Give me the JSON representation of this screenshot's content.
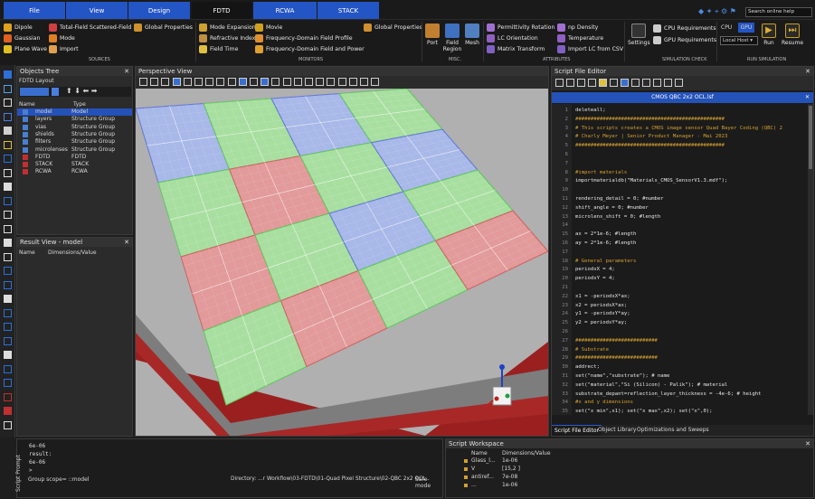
{
  "tabs": [
    "File",
    "View",
    "Design",
    "FDTD",
    "RCWA",
    "STACK"
  ],
  "search_placeholder": "Search online help",
  "sources": {
    "col1": [
      "Dipole",
      "Gaussian",
      "Plane Wave"
    ],
    "col2": [
      "Total-Field Scattered-Field",
      "Mode",
      "Import"
    ],
    "col3": [
      "Global Properties"
    ],
    "label": "Sources"
  },
  "monitors": {
    "col1": [
      "Mode Expansion",
      "Refractive Index",
      "Field Time"
    ],
    "col2": [
      "Movie",
      "Frequency-Domain Field Profile",
      "Frequency-Domain Field and Power"
    ],
    "col3": [
      "Global Properties"
    ],
    "label": "Monitors"
  },
  "misc": {
    "items": [
      "Port",
      "Field Region",
      "Mesh"
    ],
    "label": "Misc."
  },
  "attributes": {
    "col1": [
      "Permittivity Rotation",
      "LC Orientation",
      "Matrix Transform"
    ],
    "col2": [
      "np Density",
      "Temperature",
      "Import LC from CSV"
    ],
    "label": "Attributes"
  },
  "settings_label": "Settings",
  "sim_check": {
    "items": [
      "CPU Requirements",
      "GPU Requirements"
    ],
    "label": "Simulation Check"
  },
  "run_sim": {
    "cpu": "CPU",
    "gpu": "GPU",
    "host": "Local Host",
    "run": "Run",
    "resume": "Resume",
    "label": "Run Simulation"
  },
  "objects_tree": {
    "title": "Objects Tree",
    "subtitle": "FDTD Layout",
    "col_name": "Name",
    "col_type": "Type",
    "rows": [
      [
        "model",
        "Model"
      ],
      [
        "layers",
        "Structure Group"
      ],
      [
        "vias",
        "Structure Group"
      ],
      [
        "shields",
        "Structure Group"
      ],
      [
        "filters",
        "Structure Group"
      ],
      [
        "microlenses",
        "Structure Group"
      ],
      [
        "FDTD",
        "FDTD"
      ],
      [
        "STACK",
        "STACK"
      ],
      [
        "RCWA",
        "RCWA"
      ]
    ]
  },
  "result_view": {
    "title": "Result View - model",
    "col_name": "Name",
    "col_dim": "Dimensions/Value"
  },
  "perspective": {
    "title": "Perspective View"
  },
  "editor": {
    "title": "Script File Editor",
    "file": "CMOS QBC 2x2 OCL.lsf",
    "lines": [
      "deleteall;",
      "#################################################",
      "# This scripts creates a CMOS image sensor Quad Bayer Coding (QBC) 2",
      "# Charly Meyer | Senior Product Manager - Mai 2023",
      "#################################################",
      "",
      "",
      "#import materials",
      "importmaterialdb(\"Materials_CMOS_SensorV1.3.mdf\");",
      "",
      "rendering_detail = 0; #number",
      "shift_angle = 0; #number",
      "microlens_shift = 0; #length",
      "",
      "ax = 2*1e-6; #length",
      "ay = 2*1e-6; #length",
      "",
      "# General parameters",
      "periodsX = 4;",
      "periodsY = 4;",
      "",
      "x1 = -periodsX*ax;",
      "x2 = periodsX*ax;",
      "y1 = -periodsY*ay;",
      "y2 = periodsY*ay;",
      "",
      "###########################",
      "# Substrate",
      "###########################",
      "addrect;",
      "set(\"name\",\"substrate\"); # name",
      "set(\"material\",\"Si (Silicon) - Palik\"); # material",
      "substrate_depant=reflection_layer_thickness = -4e-6; # height",
      "#x and y dimensions",
      "set(\"x min\",x1); set(\"x max\",x2); set(\"x\",0);"
    ],
    "tabs": [
      "Script File Editor",
      "Object Library",
      "Optimizations and Sweeps"
    ]
  },
  "prompt": {
    "label": "Script Prompt",
    "lines": [
      "6e-06",
      "result:",
      "6e-06",
      ">"
    ],
    "scope": "Group scope= ::model",
    "directory": "Directory: ...r Workflow\\03-FDTD\\01-Quad Pixel Structure\\02-QBC 2x2 OCL",
    "mode": "Safe-mode"
  },
  "workspace": {
    "title": "Script Workspace",
    "col_name": "Name",
    "col_dim": "Dimensions/Value",
    "rows": [
      [
        "Glass_l...",
        "1e-06"
      ],
      [
        "V",
        "[15,2 ]"
      ],
      [
        "antiref...",
        "7e-08"
      ],
      [
        "...",
        "1e-06"
      ]
    ]
  }
}
